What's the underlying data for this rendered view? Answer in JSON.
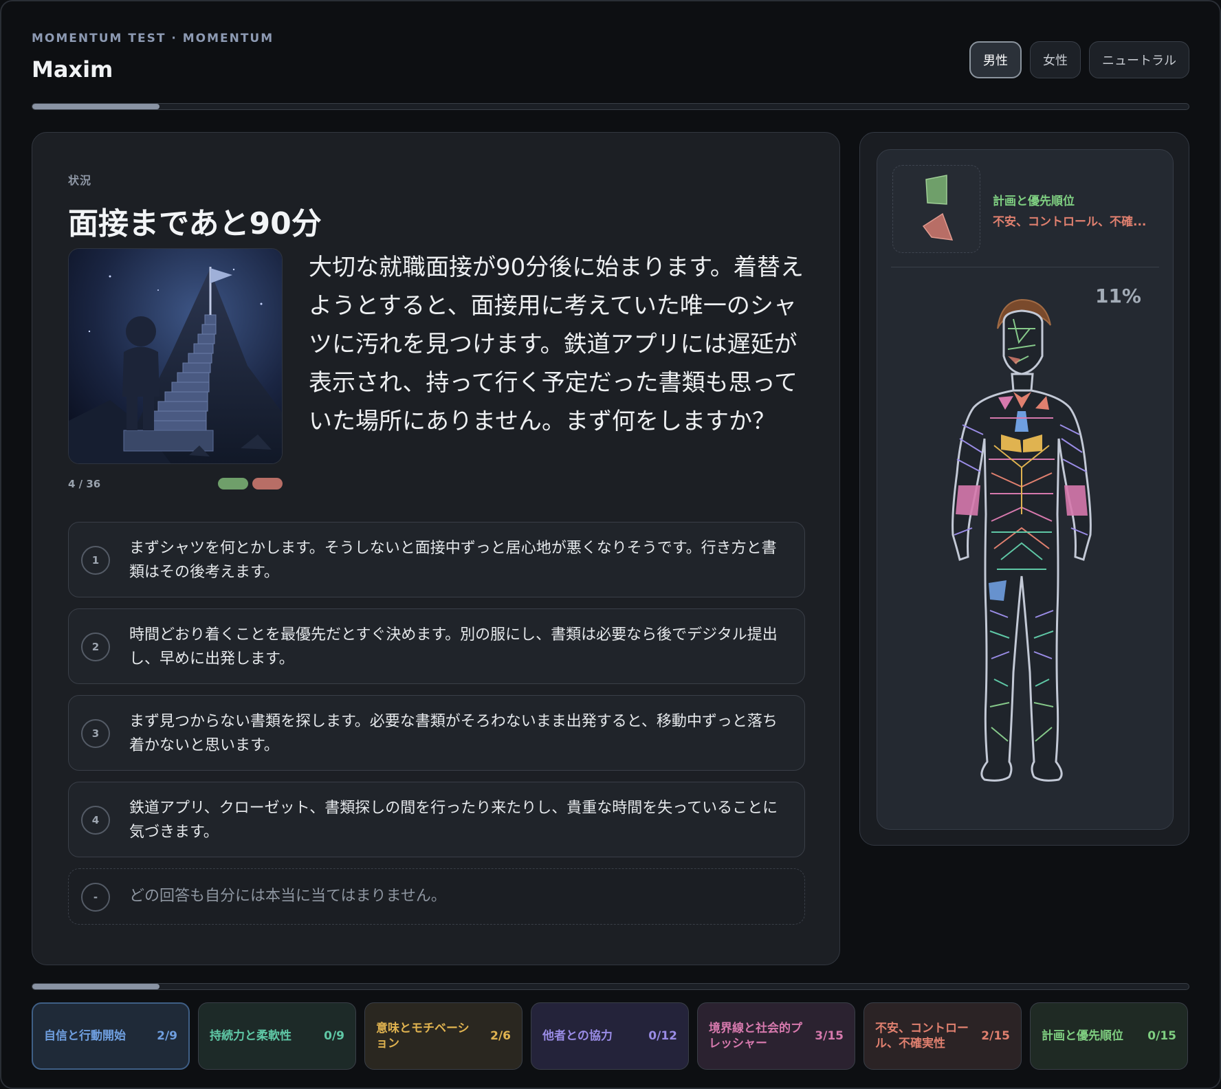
{
  "header": {
    "subtitle": "MOMENTUM TEST · MOMENTUM",
    "title": "Maxim",
    "gender_options": [
      "男性",
      "女性",
      "ニュートラル"
    ],
    "gender_selected": "男性"
  },
  "progress": {
    "overall_fraction": 0.11
  },
  "scenario": {
    "section_label": "状況",
    "title": "面接まであと90分",
    "counter": "4 / 36",
    "text": "大切な就職面接が90分後に始まります。着替えようとすると、面接用に考えていた唯一のシャツに汚れを見つけます。鉄道アプリには遅延が表示され、持って行く予定だった書類も思っていた場所にありません。まず何をしますか？"
  },
  "answers": [
    {
      "num": "1",
      "text": "まずシャツを何とかします。そうしないと面接中ずっと居心地が悪くなりそうです。行き方と書類はその後考えます。"
    },
    {
      "num": "2",
      "text": "時間どおり着くことを最優先だとすぐ決めます。別の服にし、書類は必要なら後でデジタル提出し、早めに出発します。"
    },
    {
      "num": "3",
      "text": "まず見つからない書類を探します。必要な書類がそろわないまま出発すると、移動中ずっと落ち着かないと思います。"
    },
    {
      "num": "4",
      "text": "鉄道アプリ、クローゼット、書類探しの間を行ったり来たりし、貴重な時間を失っていることに気づきます。"
    }
  ],
  "none_answer": {
    "num": "-",
    "text": "どの回答も自分には本当に当てはまりません。"
  },
  "side": {
    "legend_primary": "計画と優先順位",
    "legend_secondary": "不安、コントロール、不確...",
    "percent": "11%"
  },
  "categories": [
    {
      "label": "自信と行動開始",
      "count": "2/9",
      "color": "#6f9fe0",
      "bg": "#1f2a38",
      "active": true
    },
    {
      "label": "持続力と柔軟性",
      "count": "0/9",
      "color": "#5fc8a6",
      "bg": "#1d2a28"
    },
    {
      "label": "意味とモチベーション",
      "count": "2/6",
      "color": "#e0b350",
      "bg": "#2a2720"
    },
    {
      "label": "他者との協力",
      "count": "0/12",
      "color": "#9a8ce6",
      "bg": "#24233a"
    },
    {
      "label": "境界線と社会的プレッシャー",
      "count": "3/15",
      "color": "#d679ad",
      "bg": "#2b2230"
    },
    {
      "label": "不安、コントロール、不確実性",
      "count": "2/15",
      "color": "#e0806f",
      "bg": "#2b2325"
    },
    {
      "label": "計画と優先順位",
      "count": "0/15",
      "color": "#7fcf81",
      "bg": "#1f2a24"
    }
  ],
  "colors": {
    "accent": "#8993a3",
    "positive": "#6f9f6a",
    "negative": "#b86e66"
  }
}
